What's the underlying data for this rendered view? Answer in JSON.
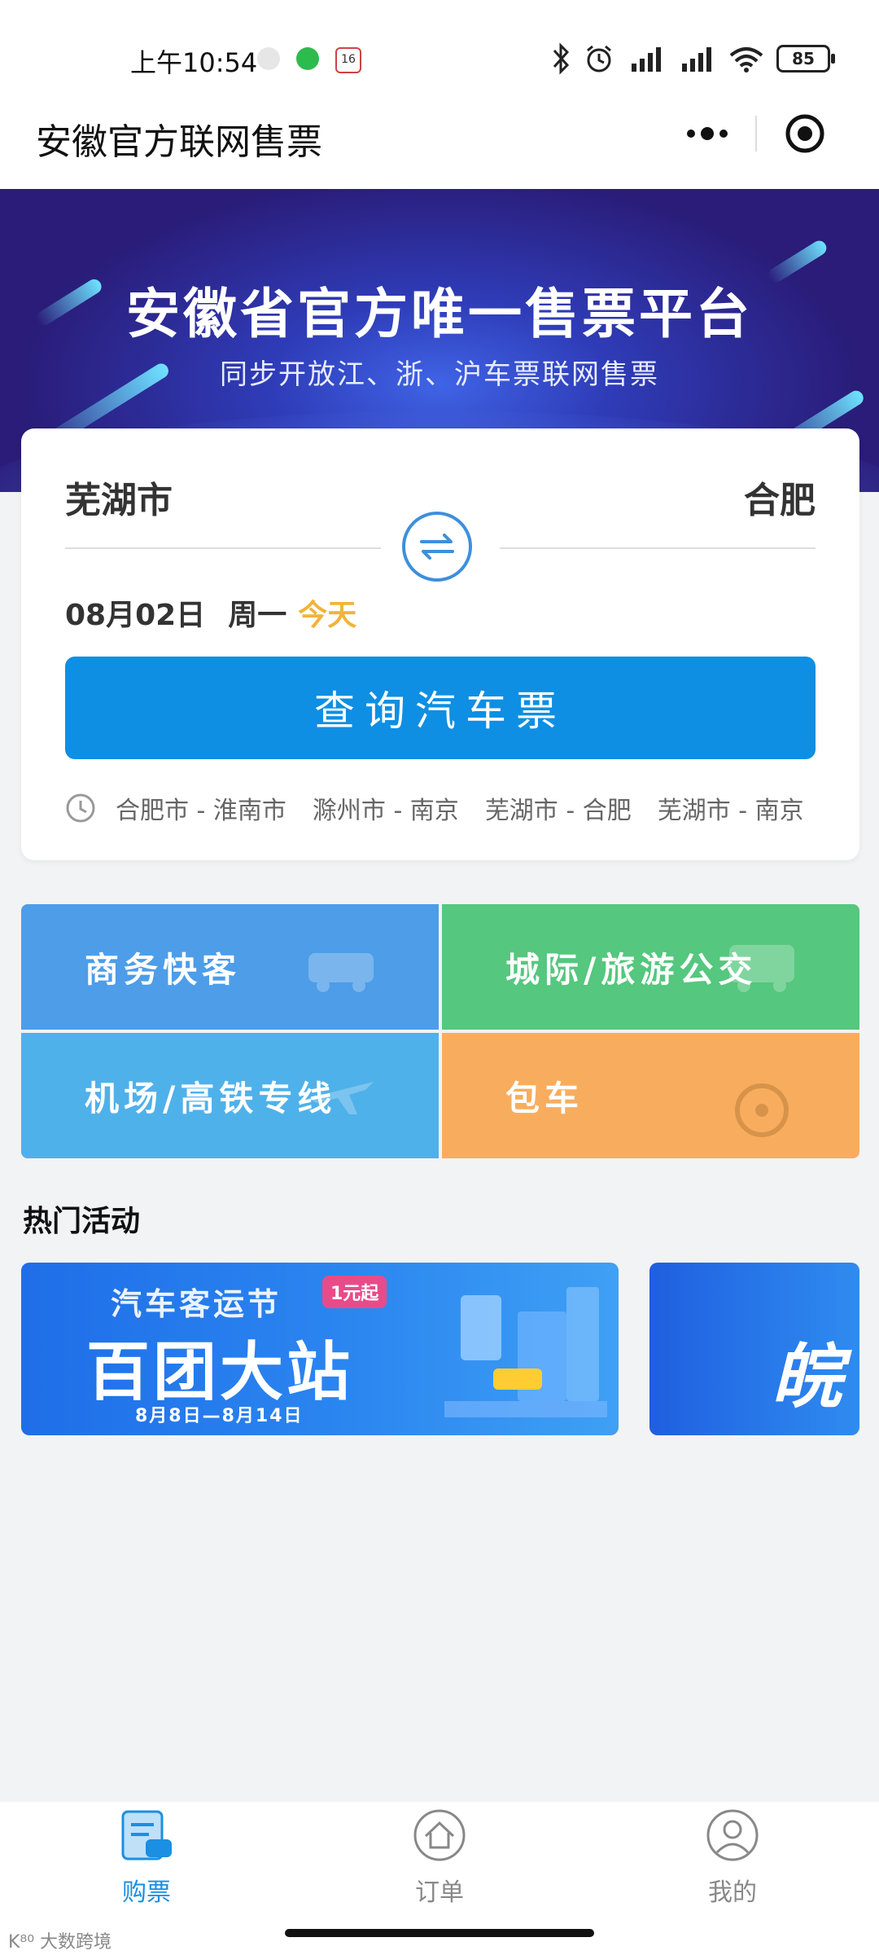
{
  "status_bar": {
    "time": "上午10:54",
    "battery": "85",
    "calendar_day": "16"
  },
  "nav": {
    "title": "安徽官方联网售票"
  },
  "banner": {
    "title": "安徽省官方唯一售票平台",
    "subtitle": "同步开放江、浙、沪车票联网售票"
  },
  "search": {
    "from": "芜湖市",
    "to": "合肥",
    "date": "08月02日",
    "weekday": "周一",
    "today_label": "今天",
    "button_label": "查询汽车票",
    "history": [
      "合肥市 - 淮南市",
      "滁州市 - 南京",
      "芜湖市 - 合肥",
      "芜湖市 - 南京"
    ]
  },
  "services": [
    {
      "label": "商务快客",
      "color": "#4d9de8"
    },
    {
      "label": "城际/旅游公交",
      "color": "#55c77e"
    },
    {
      "label": "机场/高铁专线",
      "color": "#4fb1ea"
    },
    {
      "label": "包车",
      "color": "#f8ad5e"
    }
  ],
  "activities": {
    "title": "热门活动",
    "promo1": {
      "subtitle": "汽车客运节",
      "tag": "1元起",
      "main": "百团大站",
      "dates": "8月8日—8月14日"
    },
    "promo2": {
      "text": "皖"
    }
  },
  "tabs": [
    {
      "label": "购票",
      "icon": "ticket-icon",
      "active": true
    },
    {
      "label": "订单",
      "icon": "home-icon",
      "active": false
    },
    {
      "label": "我的",
      "icon": "user-icon",
      "active": false
    }
  ],
  "watermark": "K⁸⁰ 大数跨境"
}
